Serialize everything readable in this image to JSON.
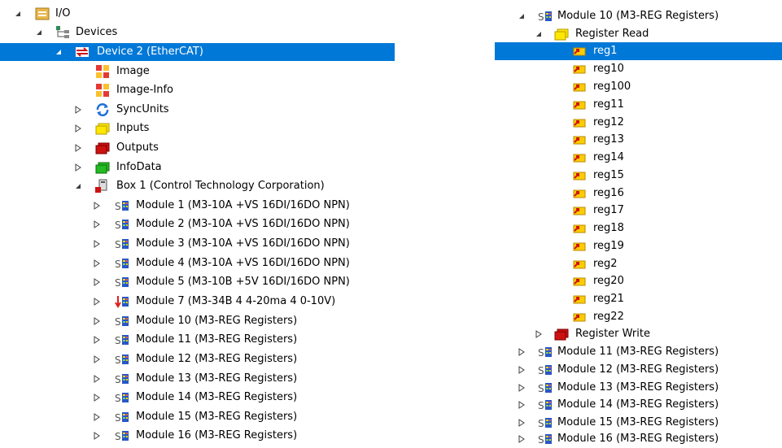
{
  "left_tree": {
    "io": {
      "label": "I/O"
    },
    "devices": {
      "label": "Devices"
    },
    "device2": {
      "label": "Device 2 (EtherCAT)"
    },
    "image": {
      "label": "Image"
    },
    "image_info": {
      "label": "Image-Info"
    },
    "syncunits": {
      "label": "SyncUnits"
    },
    "inputs": {
      "label": "Inputs"
    },
    "outputs": {
      "label": "Outputs"
    },
    "infodata": {
      "label": "InfoData"
    },
    "box1": {
      "label": "Box 1 (Control Technology Corporation)"
    },
    "modules": [
      {
        "label": "Module 1 (M3-10A +VS 16DI/16DO NPN)"
      },
      {
        "label": "Module 2 (M3-10A +VS 16DI/16DO NPN)"
      },
      {
        "label": "Module 3 (M3-10A +VS 16DI/16DO NPN)"
      },
      {
        "label": "Module 4 (M3-10A +VS 16DI/16DO NPN)"
      },
      {
        "label": "Module 5 (M3-10B +5V 16DI/16DO NPN)"
      },
      {
        "label": "Module 7 (M3-34B 4 4-20ma 4 0-10V)"
      },
      {
        "label": "Module 10 (M3-REG Registers)"
      },
      {
        "label": "Module 11 (M3-REG Registers)"
      },
      {
        "label": "Module 12 (M3-REG Registers)"
      },
      {
        "label": "Module 13 (M3-REG Registers)"
      },
      {
        "label": "Module 14 (M3-REG Registers)"
      },
      {
        "label": "Module 15 (M3-REG Registers)"
      },
      {
        "label": "Module 16 (M3-REG Registers)"
      }
    ]
  },
  "right_tree": {
    "module10": {
      "label": "Module 10 (M3-REG Registers)"
    },
    "register_read": {
      "label": "Register Read"
    },
    "registers": [
      {
        "label": "reg1"
      },
      {
        "label": "reg10"
      },
      {
        "label": "reg100"
      },
      {
        "label": "reg11"
      },
      {
        "label": "reg12"
      },
      {
        "label": "reg13"
      },
      {
        "label": "reg14"
      },
      {
        "label": "reg15"
      },
      {
        "label": "reg16"
      },
      {
        "label": "reg17"
      },
      {
        "label": "reg18"
      },
      {
        "label": "reg19"
      },
      {
        "label": "reg2"
      },
      {
        "label": "reg20"
      },
      {
        "label": "reg21"
      },
      {
        "label": "reg22"
      }
    ],
    "register_write": {
      "label": "Register Write"
    },
    "modules": [
      {
        "label": "Module 11 (M3-REG Registers)"
      },
      {
        "label": "Module 12 (M3-REG Registers)"
      },
      {
        "label": "Module 13 (M3-REG Registers)"
      },
      {
        "label": "Module 14 (M3-REG Registers)"
      },
      {
        "label": "Module 15 (M3-REG Registers)"
      },
      {
        "label": "Module 16 (M3-REG Registers)"
      }
    ]
  },
  "colors": {
    "selection": "#0078d7",
    "input_yellow": "#ffe600",
    "output_red": "#cc1111",
    "infodata_green": "#22bb22"
  }
}
